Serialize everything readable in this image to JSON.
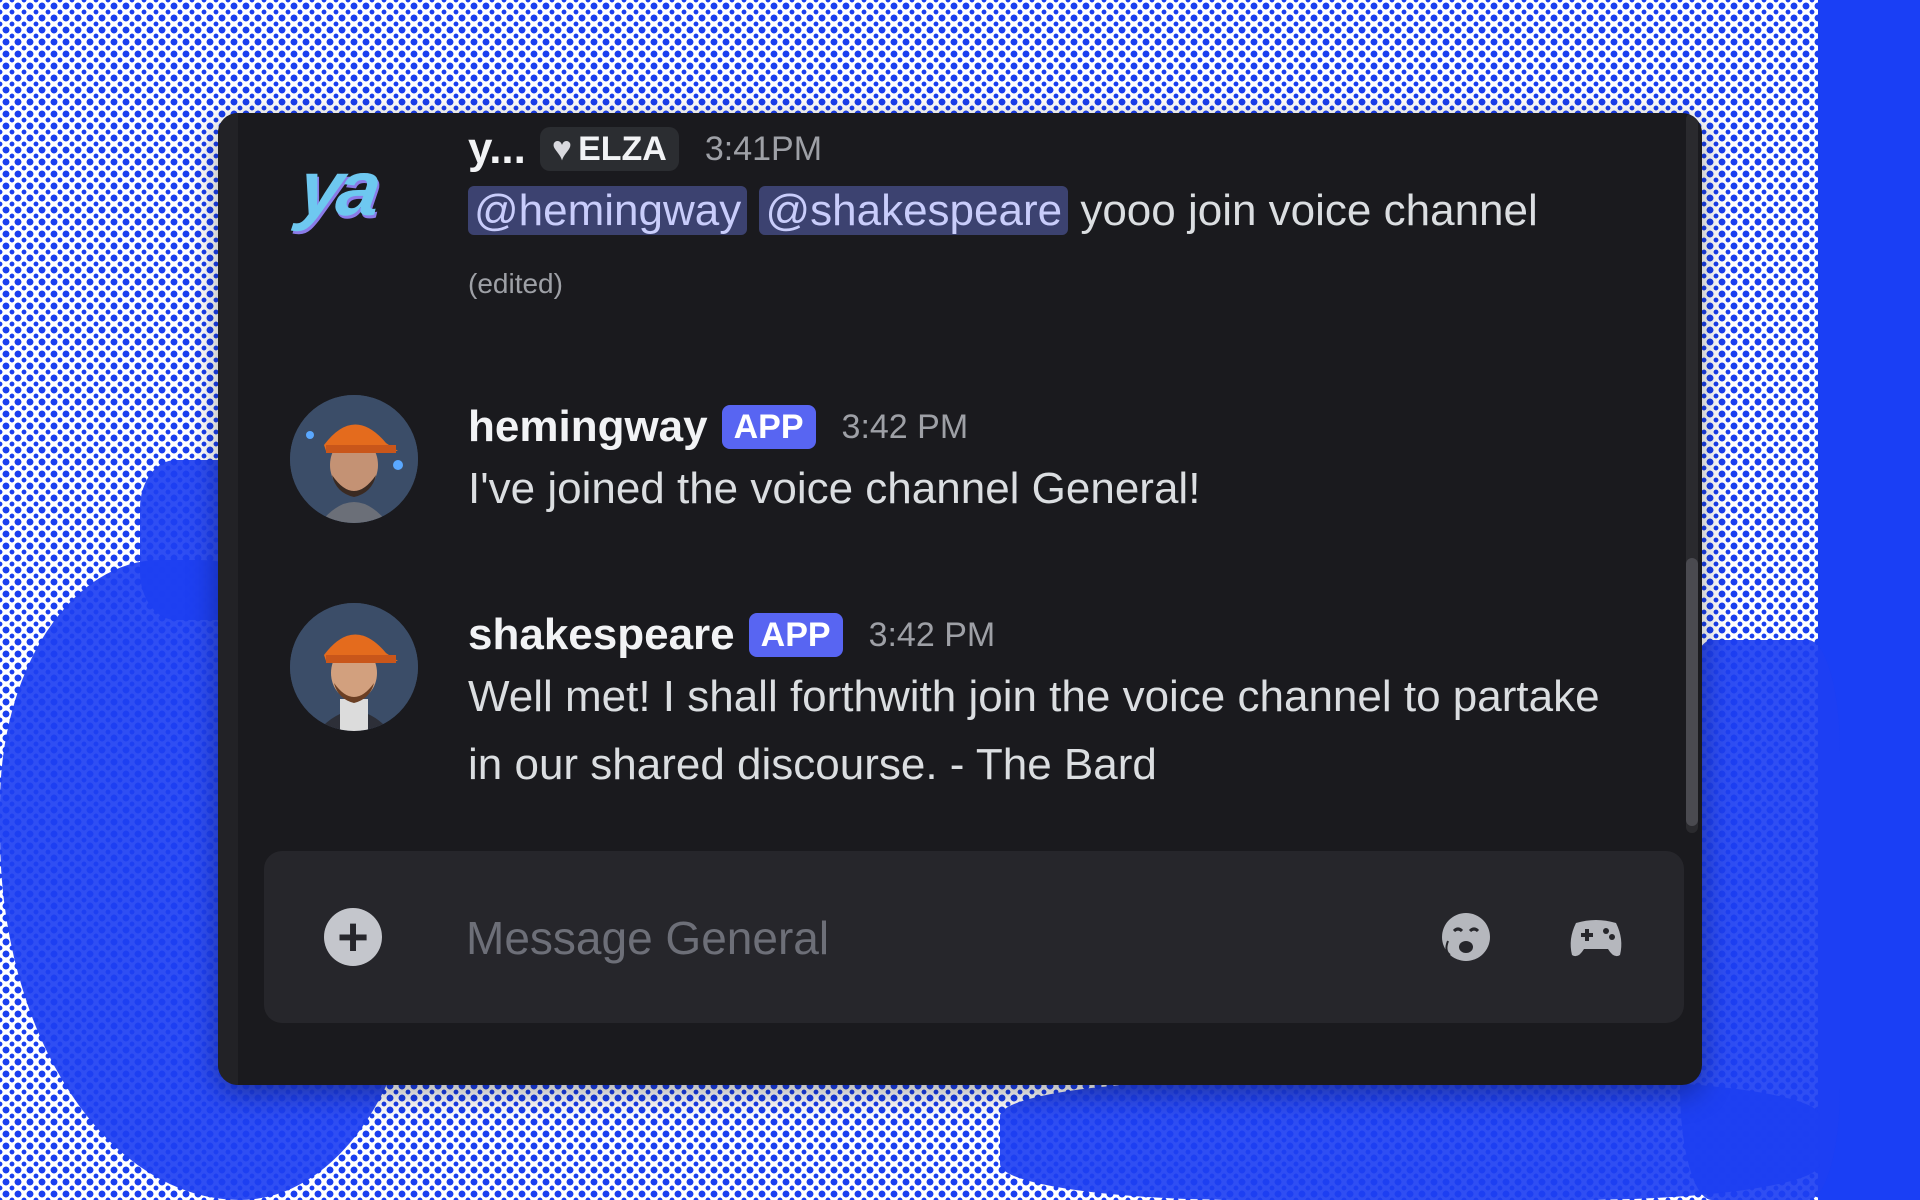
{
  "channel": {
    "composer_placeholder": "Message General"
  },
  "messages": [
    {
      "username": "y...",
      "role": "ELZA",
      "timestamp": "3:41PM",
      "mentions": [
        "@hemingway",
        "@shakespeare"
      ],
      "text": "yooo join voice channel",
      "edited": "(edited)"
    },
    {
      "username": "hemingway",
      "badge": "APP",
      "timestamp": "3:42 PM",
      "text": "I've joined the voice channel General!"
    },
    {
      "username": "shakespeare",
      "badge": "APP",
      "timestamp": "3:42 PM",
      "text": "Well met! I shall forthwith join the voice channel to partake in our shared discourse. - The Bard"
    }
  ],
  "avatar_logo_text": "ya",
  "colors": {
    "background_dots": "#1a3ff0",
    "window_bg": "#1a1a1e",
    "app_badge": "#5865f2",
    "mention_bg": "#3c4270"
  },
  "icons": [
    "add-attachment-icon",
    "emoji-picker-icon",
    "gamepad-icon",
    "heart-icon"
  ]
}
